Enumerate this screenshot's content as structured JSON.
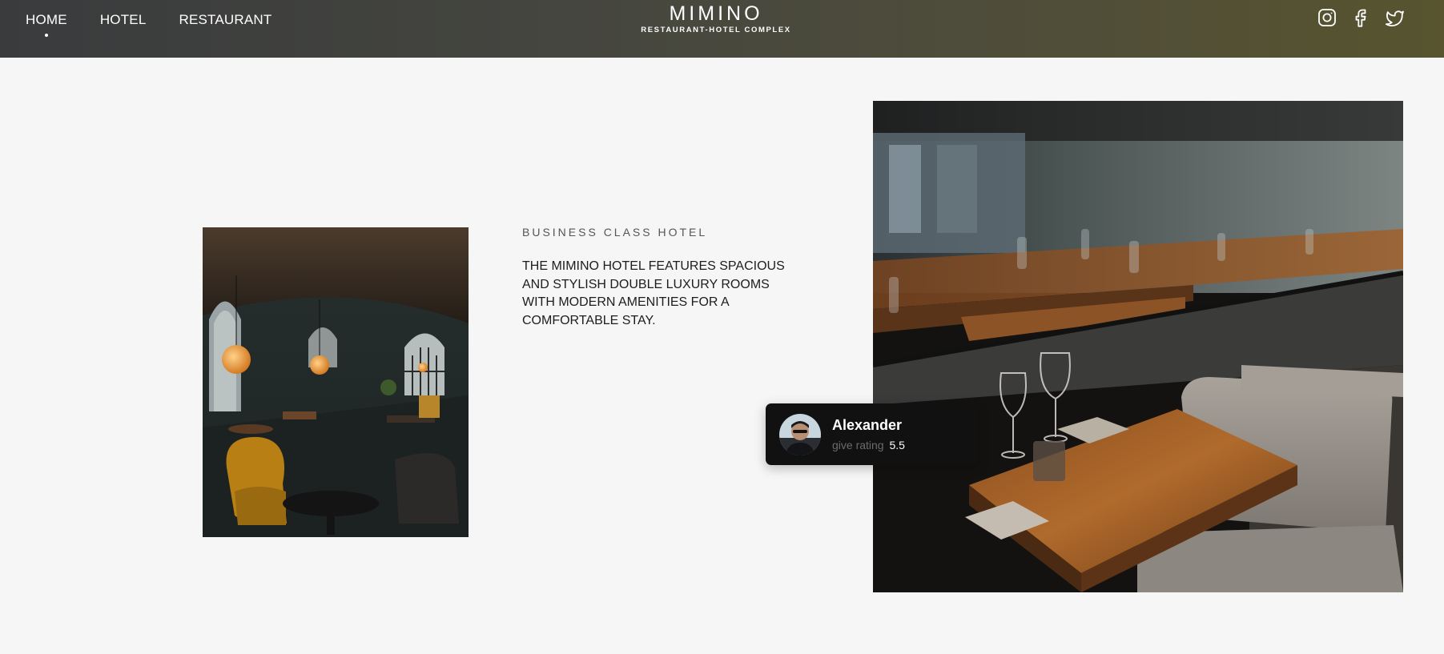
{
  "nav": {
    "items": [
      {
        "label": "HOME",
        "active": true
      },
      {
        "label": "HOTEL",
        "active": false
      },
      {
        "label": "RESTAURANT",
        "active": false
      }
    ]
  },
  "brand": {
    "title": "MIMINO",
    "subtitle": "RESTAURANT-HOTEL COMPLEX"
  },
  "social": {
    "icons": [
      "instagram-icon",
      "facebook-icon",
      "twitter-icon"
    ]
  },
  "hero": {
    "eyebrow": "BUSINESS CLASS HOTEL",
    "description": "THE MIMINO HOTEL FEATURES SPACIOUS AND STYLISH DOUBLE LUXURY ROOMS WITH MODERN AMENITIES FOR A COMFORTABLE STAY."
  },
  "rating_card": {
    "name": "Alexander",
    "label": "give rating",
    "value": "5.5"
  },
  "colors": {
    "header_start": "#393b3d",
    "header_end": "#57542f",
    "page_bg": "#f6f6f6",
    "card_bg": "#111112"
  }
}
